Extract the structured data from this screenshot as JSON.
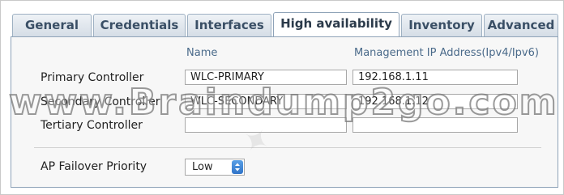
{
  "tabs": [
    {
      "label": "General",
      "active": false
    },
    {
      "label": "Credentials",
      "active": false
    },
    {
      "label": "Interfaces",
      "active": false
    },
    {
      "label": "High availability",
      "active": true
    },
    {
      "label": "Inventory",
      "active": false
    },
    {
      "label": "Advanced",
      "active": false
    }
  ],
  "columns": {
    "name": "Name",
    "ip": "Management IP Address(Ipv4/Ipv6)"
  },
  "controllers": [
    {
      "label": "Primary Controller",
      "name": "WLC-PRIMARY",
      "ip": "192.168.1.11"
    },
    {
      "label": "Secondary Controller",
      "name": "WLC-SECONDARY",
      "ip": "192.168.1.12"
    },
    {
      "label": "Tertiary Controller",
      "name": "",
      "ip": ""
    }
  ],
  "failover": {
    "label": "AP Failover Priority",
    "value": "Low"
  },
  "watermark": "www.Braindump2go.com",
  "colors": {
    "tab_text": "#3a4f66",
    "column_header": "#4a6a8a",
    "stepper": "#2f73c8"
  }
}
